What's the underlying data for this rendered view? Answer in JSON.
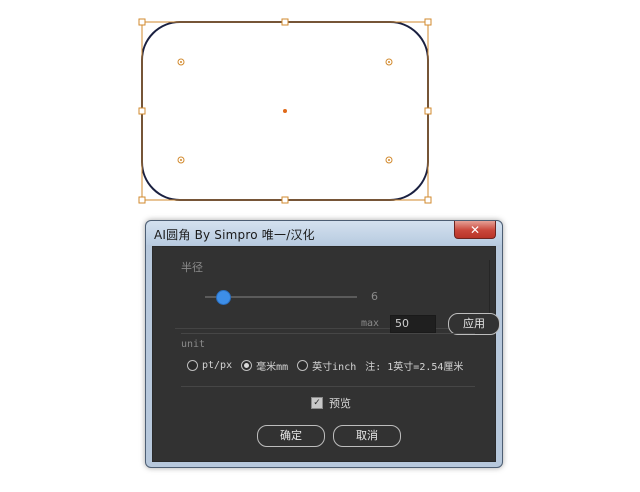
{
  "dialog": {
    "title": "AI圆角 By Simpro 唯一/汉化",
    "close_glyph": "✕",
    "radius": {
      "section_label": "半径",
      "slider_value": "6",
      "slider_fraction": 0.12,
      "max_label": "max",
      "max_value": "50",
      "apply_label": "应用"
    },
    "unit": {
      "section_label": "unit",
      "options": [
        "pt/px",
        "毫米mm",
        "英寸inch"
      ],
      "selected_index": 1,
      "note": "注: 1英寸=2.54厘米"
    },
    "preview": {
      "label": "预览",
      "checked": true
    },
    "ok_label": "确定",
    "cancel_label": "取消"
  },
  "colors": {
    "accent": "#3d8ee8",
    "shape_stroke": "#1a2040",
    "selection": "#d28a2e"
  },
  "icons": [
    "close-icon",
    "check-icon"
  ]
}
